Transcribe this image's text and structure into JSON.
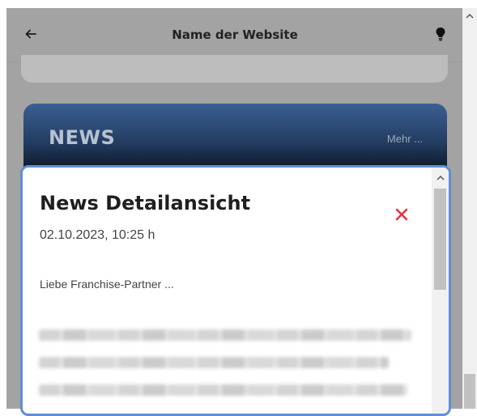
{
  "header": {
    "title": "Name der Website",
    "back_icon": "arrow-left-icon",
    "right_icon": "lightbulb-icon"
  },
  "news_section": {
    "title": "NEWS",
    "more_link": "Mehr ..."
  },
  "modal": {
    "title": "News Detailansicht",
    "date": "02.10.2023, 10:25 h",
    "greeting": "Liebe Franchise-Partner ...",
    "close_icon": "close-icon",
    "close_color": "#e03545",
    "border_color": "#5d8fd6"
  },
  "colors": {
    "overlay_gray": "#a3a3a3",
    "news_gradient_top": "#3b5f93",
    "news_gradient_bottom": "#000000"
  }
}
